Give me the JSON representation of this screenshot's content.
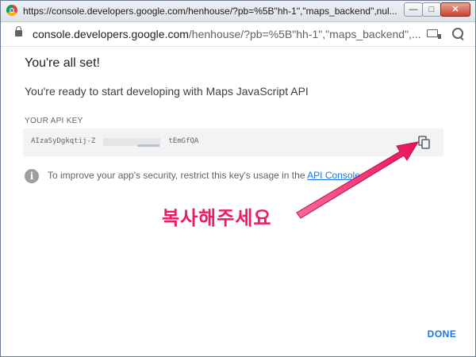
{
  "window": {
    "title": "https://console.developers.google.com/henhouse/?pb=%5B\"hh-1\",\"maps_backend\",nul...",
    "minimize_label": "—",
    "maximize_label": "□",
    "close_label": "✕"
  },
  "address_bar": {
    "url_host": "console.developers.google.com",
    "url_path": "/henhouse/?pb=%5B\"hh-1\",\"maps_backend\",..."
  },
  "dialog": {
    "heading": "You're all set!",
    "subheading": "You're ready to start developing with Maps JavaScript API",
    "api_key_label": "YOUR API KEY",
    "api_key_value": "AIzaSyDgkqtij-Z                 tEmGfQA",
    "info_text": "To improve your app's security, restrict this key's usage in the ",
    "info_link": "API Console",
    "info_suffix": ".",
    "done_label": "DONE"
  },
  "annotation": {
    "text": "복사해주세요",
    "color": "#f01a64"
  },
  "icons": {
    "favicon": "chrome-favicon",
    "lock": "lock-icon",
    "cast": "cast-icon",
    "zoom": "zoom-icon",
    "copy": "copy-icon",
    "info": "info-icon"
  },
  "colors": {
    "link": "#1a73e8",
    "key_box": "#f1f3f4",
    "annotation_arrow": "#f01a64"
  }
}
